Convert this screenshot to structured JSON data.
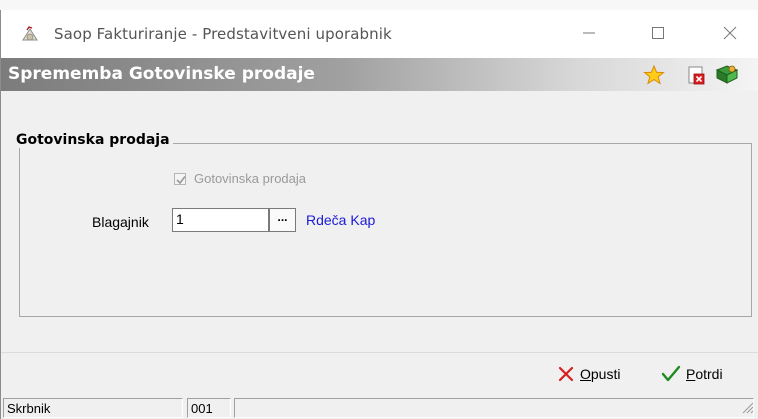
{
  "window": {
    "title": "Saop Fakturiranje - Predstavitveni uporabnik",
    "controls": [
      "minimize-icon",
      "maximize-icon",
      "close-icon"
    ]
  },
  "header": {
    "title": "Sprememba Gotovinske prodaje",
    "icons": [
      "star-icon",
      "document-delete-icon",
      "book-exit-icon"
    ]
  },
  "group": {
    "title": "Gotovinska prodaja",
    "checkbox": {
      "label": "Gotovinska prodaja",
      "checked": true,
      "disabled": true
    },
    "cashier": {
      "label": "Blagajnik",
      "value": "1",
      "browse_label": "...",
      "name": "Rdeča Kap"
    }
  },
  "footer": {
    "cancel": {
      "label": "Opusti",
      "hotkey": "O"
    },
    "confirm": {
      "label": "Potrdi",
      "hotkey": "P"
    }
  },
  "statusbar": {
    "user": "Skrbnik",
    "code": "001",
    "extra": ""
  },
  "colors": {
    "link": "#1a1ad6",
    "cancel_icon": "#d61f1f",
    "confirm_icon": "#1f8a1f"
  }
}
